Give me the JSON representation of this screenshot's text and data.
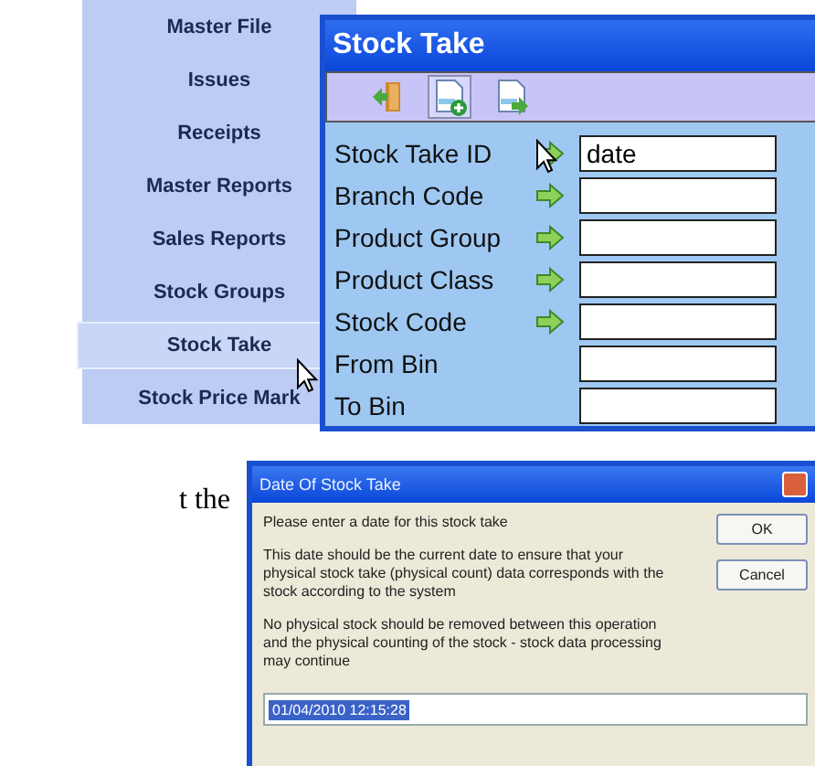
{
  "page_text": "t the",
  "menu": {
    "items": [
      {
        "label": "Master File",
        "selected": false
      },
      {
        "label": "Issues",
        "selected": false
      },
      {
        "label": "Receipts",
        "selected": false
      },
      {
        "label": "Master Reports",
        "selected": false
      },
      {
        "label": "Sales Reports",
        "selected": false
      },
      {
        "label": "Stock Groups",
        "selected": false
      },
      {
        "label": "Stock Take",
        "selected": true
      },
      {
        "label": "Stock Price Mark",
        "selected": false
      }
    ]
  },
  "stock_take_window": {
    "title": "Stock Take",
    "toolbar": [
      {
        "kind": "exit"
      },
      {
        "kind": "new"
      },
      {
        "kind": "next"
      }
    ],
    "fields": [
      {
        "label": "Stock Take ID",
        "kind": "lookup",
        "value": "date"
      },
      {
        "label": "Branch Code",
        "kind": "lookup"
      },
      {
        "label": "Product Group",
        "kind": "lookup"
      },
      {
        "label": "Product Class",
        "kind": "lookup"
      },
      {
        "label": "Stock Code",
        "kind": "lookup"
      },
      {
        "label": "From Bin",
        "kind": "plain"
      },
      {
        "label": "To Bin",
        "kind": "plain"
      }
    ]
  },
  "dialog": {
    "title": "Date Of Stock Take",
    "paragraphs": [
      "Please enter a date for this stock take",
      "This date should be the current date to ensure that your physical stock take (physical count) data corresponds with the stock according to the system",
      "No physical stock should be removed between this operation and the physical counting of the stock - stock data processing may continue"
    ],
    "buttons": [
      "OK",
      "Cancel"
    ],
    "value": "01/04/2010 12:15:28"
  }
}
